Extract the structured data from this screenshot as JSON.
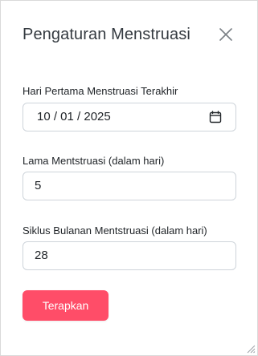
{
  "modal": {
    "title": "Pengaturan Menstruasi",
    "close_icon": "close-icon"
  },
  "fields": {
    "last_period": {
      "label": "Hari Pertama Menstruasi Terakhir",
      "value": "10 / 01 / 2025",
      "icon": "calendar-icon"
    },
    "duration": {
      "label": "Lama Mentstruasi (dalam hari)",
      "value": "5"
    },
    "cycle": {
      "label": "Siklus Bulanan Mentstruasi (dalam hari)",
      "value": "28"
    }
  },
  "actions": {
    "apply_label": "Terapkan"
  },
  "colors": {
    "accent": "#ff4d68",
    "border": "#ced4da",
    "title": "#343a40"
  }
}
